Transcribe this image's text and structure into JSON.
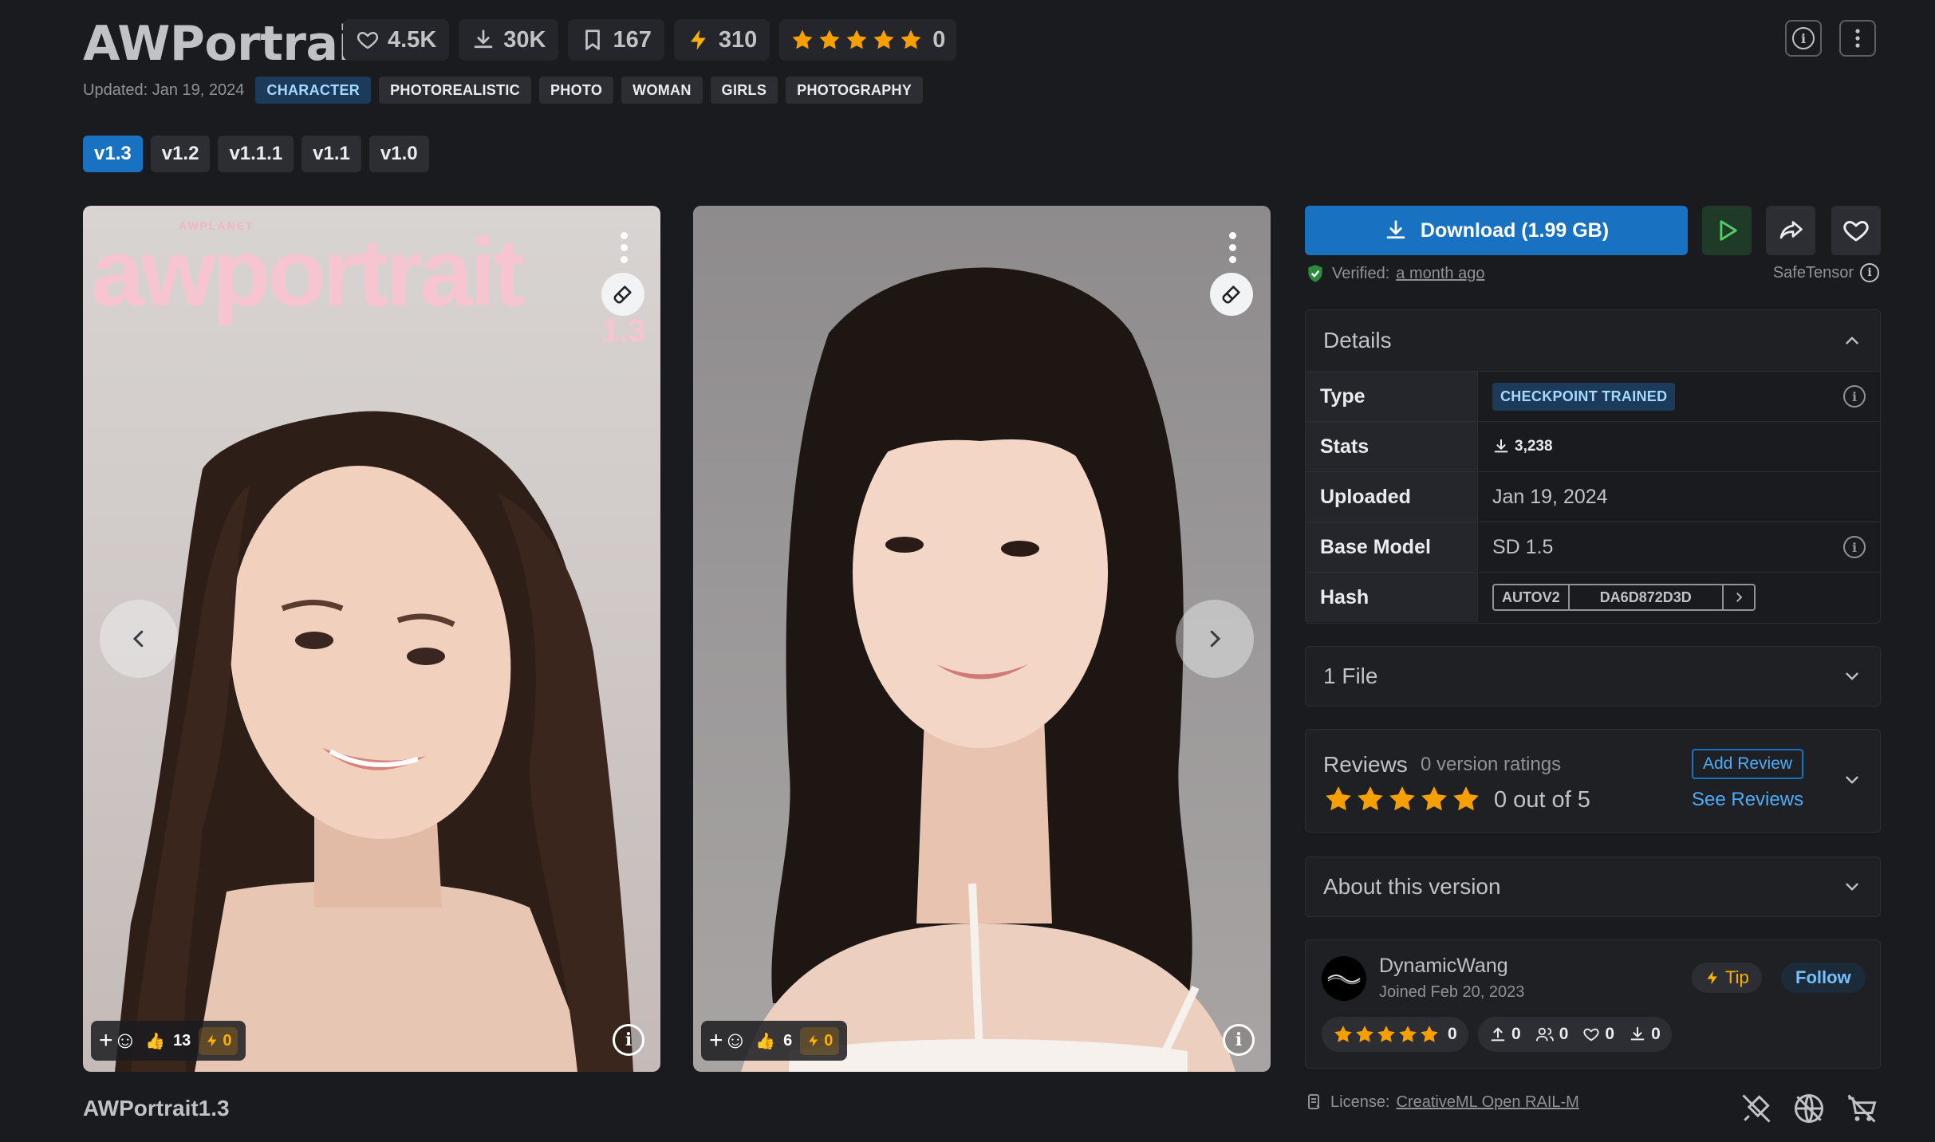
{
  "model": {
    "title": "AWPortrait",
    "stats": {
      "likes": "4.5K",
      "downloads": "30K",
      "bookmarks": "167",
      "buzz": "310",
      "rating_count": "0"
    },
    "updated": "Updated: Jan 19, 2024",
    "tags": [
      "CHARACTER",
      "PHOTOREALISTIC",
      "PHOTO",
      "WOMAN",
      "GIRLS",
      "PHOTOGRAPHY"
    ],
    "versions": [
      "v1.3",
      "v1.2",
      "v1.1.1",
      "v1.1",
      "v1.0"
    ],
    "active_version": "v1.3"
  },
  "gallery": {
    "cards": [
      {
        "thumbs": "13",
        "buzz": "0"
      },
      {
        "thumbs": "6",
        "buzz": "0"
      }
    ],
    "caption": "AWPortrait1.3",
    "cover_text": {
      "brand": "AWPLANET",
      "word": "awportrait",
      "version": "1.3"
    }
  },
  "actions": {
    "download_label": "Download (1.99 GB)",
    "verified_label": "Verified:",
    "verified_time": "a month ago",
    "safetensor_label": "SafeTensor"
  },
  "details": {
    "heading": "Details",
    "rows": {
      "type_key": "Type",
      "type_value": "CHECKPOINT TRAINED",
      "stats_key": "Stats",
      "stats_value": "3,238",
      "uploaded_key": "Uploaded",
      "uploaded_value": "Jan 19, 2024",
      "base_key": "Base Model",
      "base_value": "SD 1.5",
      "hash_key": "Hash",
      "hash_type": "AUTOV2",
      "hash_value": "DA6D872D3D"
    }
  },
  "files": {
    "heading": "1 File"
  },
  "reviews": {
    "heading": "Reviews",
    "subheading": "0 version ratings",
    "score": "0 out of 5",
    "add_label": "Add Review",
    "see_label": "See Reviews"
  },
  "about": {
    "heading": "About this version"
  },
  "creator": {
    "name": "DynamicWang",
    "joined": "Joined Feb 20, 2023",
    "tip_label": "Tip",
    "follow_label": "Follow",
    "rating_count": "0",
    "uploads": "0",
    "followers": "0",
    "likes": "0",
    "downloads": "0"
  },
  "license": {
    "label": "License:",
    "name": "CreativeML Open RAIL-M"
  },
  "colors": {
    "accent": "#1971c2",
    "star": "#f59f00",
    "background": "#1a1b1e"
  },
  "icons": [
    "heart-icon",
    "download-icon",
    "bookmark-icon",
    "lightning-icon",
    "star-icon",
    "info-icon",
    "more-icon",
    "play-icon",
    "share-icon",
    "chevron-up-icon",
    "chevron-down-icon",
    "brush-icon",
    "license-icon",
    "no-sell-icon",
    "no-generation-icon",
    "no-commercial-icon"
  ]
}
